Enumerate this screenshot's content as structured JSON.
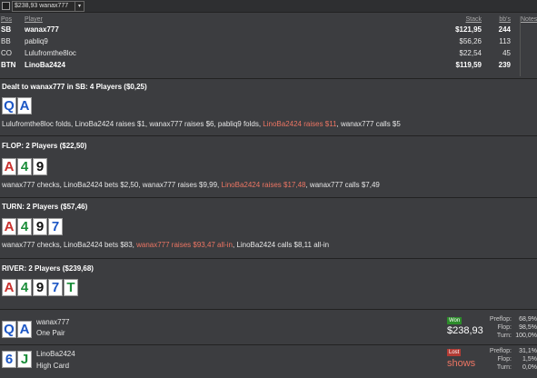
{
  "topbar": {
    "selector_value": "$238,93 wanax777",
    "arrow": "▾"
  },
  "table": {
    "headers": {
      "pos": "Pos",
      "player": "Player",
      "stack": "Stack",
      "bbs": "bb's",
      "notes": "Notes"
    },
    "rows": [
      {
        "pos": "SB",
        "name": "wanax777",
        "stack": "$121,95",
        "bbs": "244",
        "bold": true
      },
      {
        "pos": "BB",
        "name": "pabliq9",
        "stack": "$56,26",
        "bbs": "113",
        "bold": false
      },
      {
        "pos": "CO",
        "name": "Lulufromthe8loc",
        "stack": "$22,54",
        "bbs": "45",
        "bold": false
      },
      {
        "pos": "BTN",
        "name": "LinoBa2424",
        "stack": "$119,59",
        "bbs": "239",
        "bold": true
      }
    ]
  },
  "preflop": {
    "title": "Dealt to wanax777 in SB: 4 Players ($0,25)",
    "cards": [
      {
        "r": "Q",
        "c": "#1d57c5"
      },
      {
        "r": "A",
        "c": "#1d57c5"
      }
    ],
    "action_pre": "Lulufromthe8loc folds, LinoBa2424 raises $1, wanax777 raises $6, pabliq9 folds, ",
    "action_hl": "LinoBa2424 raises $11",
    "action_post": ", wanax777 calls $5"
  },
  "flop": {
    "title": "FLOP: 2 Players ($22,50)",
    "cards": [
      {
        "r": "A",
        "c": "#c9302c"
      },
      {
        "r": "4",
        "c": "#1b8d3a"
      },
      {
        "r": "9",
        "c": "#111111"
      }
    ],
    "action_pre": "wanax777 checks, LinoBa2424 bets $2,50, wanax777 raises $9,99, ",
    "action_hl": "LinoBa2424 raises $17,48",
    "action_post": ", wanax777 calls $7,49"
  },
  "turn": {
    "title": "TURN: 2 Players ($57,46)",
    "cards": [
      {
        "r": "A",
        "c": "#c9302c"
      },
      {
        "r": "4",
        "c": "#1b8d3a"
      },
      {
        "r": "9",
        "c": "#111111"
      },
      {
        "r": "7",
        "c": "#1d57c5"
      }
    ],
    "action_pre": "wanax777 checks, LinoBa2424 bets $83, ",
    "action_hl": "wanax777 raises $93,47 all-in",
    "action_post": ", LinoBa2424 calls $8,11 all-in"
  },
  "river": {
    "title": "RIVER: 2 Players ($239,68)",
    "cards": [
      {
        "r": "A",
        "c": "#c9302c"
      },
      {
        "r": "4",
        "c": "#1b8d3a"
      },
      {
        "r": "9",
        "c": "#111111"
      },
      {
        "r": "7",
        "c": "#1d57c5"
      },
      {
        "r": "T",
        "c": "#1b8d3a"
      }
    ]
  },
  "results": [
    {
      "cards": [
        {
          "r": "Q",
          "c": "#1d57c5"
        },
        {
          "r": "A",
          "c": "#1d57c5"
        }
      ],
      "player": "wanax777",
      "hand": "One Pair",
      "badge": "Won",
      "amount": "$238,93",
      "equity": [
        {
          "label": "Preflop:",
          "value": "68,9%"
        },
        {
          "label": "Flop:",
          "value": "98,5%"
        },
        {
          "label": "Turn:",
          "value": "100,0%"
        }
      ]
    },
    {
      "cards": [
        {
          "r": "6",
          "c": "#1d57c5"
        },
        {
          "r": "J",
          "c": "#1b8d3a"
        }
      ],
      "player": "LinoBa2424",
      "hand": "High Card",
      "badge": "Lost",
      "amount": "shows",
      "equity": [
        {
          "label": "Preflop:",
          "value": "31,1%"
        },
        {
          "label": "Flop:",
          "value": "1,5%"
        },
        {
          "label": "Turn:",
          "value": "0,0%"
        }
      ]
    }
  ]
}
